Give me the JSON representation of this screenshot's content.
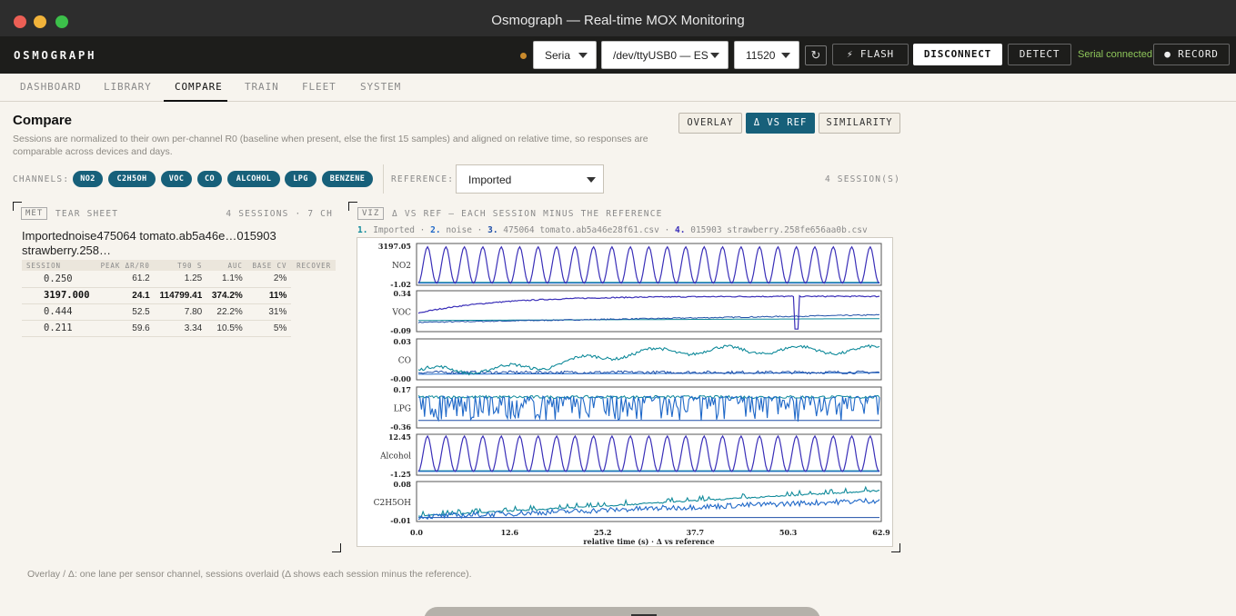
{
  "window": {
    "title": "Osmograph — Real-time MOX Monitoring"
  },
  "header": {
    "brand": "OSMOGRAPH",
    "protocol_value": "Seria",
    "port_value": "/dev/ttyUSB0 — ES",
    "baud_value": "11520",
    "refresh_glyph": "↻",
    "flash_label": "⚡ FLASH",
    "disconnect_label": "DISCONNECT",
    "detect_label": "DETECT",
    "connection_status": "Serial connected",
    "record_label": "● RECORD"
  },
  "nav": {
    "tabs": [
      {
        "label": "DASHBOARD"
      },
      {
        "label": "LIBRARY"
      },
      {
        "label": "COMPARE"
      },
      {
        "label": "TRAIN"
      },
      {
        "label": "FLEET"
      },
      {
        "label": "SYSTEM"
      }
    ],
    "active": "COMPARE"
  },
  "compare": {
    "title": "Compare",
    "description": "Sessions are normalized to their own per-channel R0 (baseline when present, else the first 15 samples) and aligned on relative time, so responses are comparable across devices and days.",
    "view_buttons": [
      {
        "label": "OVERLAY"
      },
      {
        "label": "Δ VS REF"
      },
      {
        "label": "SIMILARITY"
      }
    ],
    "channels_label": "CHANNELS:",
    "channels": [
      "NO2",
      "C2H5OH",
      "VOC",
      "CO",
      "ALCOHOL",
      "LPG",
      "BENZENE"
    ],
    "reference_label": "REFERENCE:",
    "reference_value": "Imported",
    "session_count": "4 SESSION(S)"
  },
  "tear_sheet": {
    "badge": "MET",
    "label": "TEAR SHEET",
    "meta": "4 SESSIONS · 7 CH",
    "title": "Importednoise475064 tomato.ab5a46e…015903 strawberry.258…",
    "columns": [
      "SESSION",
      "PEAK ΔR/R0",
      "T90 S",
      "AUC",
      "BASE CV",
      "RECOVER"
    ],
    "rows": [
      [
        "0.250",
        "61.2",
        "1.25",
        "1.1%",
        "2%",
        ""
      ],
      [
        "3197.000",
        "24.1",
        "114799.41",
        "374.2%",
        "11%",
        ""
      ],
      [
        "0.444",
        "52.5",
        "7.80",
        "22.2%",
        "31%",
        ""
      ],
      [
        "0.211",
        "59.6",
        "3.34",
        "10.5%",
        "5%",
        ""
      ]
    ]
  },
  "viz": {
    "badge": "VIZ",
    "label": "Δ VS REF — EACH SESSION MINUS THE REFERENCE",
    "legend": [
      {
        "num": "1.",
        "name": "Imported"
      },
      {
        "num": "2.",
        "name": "noise"
      },
      {
        "num": "3.",
        "name": "475064 tomato.ab5a46e28f61.csv"
      },
      {
        "num": "4.",
        "name": "015903 strawberry.258fe656aa0b.csv"
      }
    ]
  },
  "chart_data": {
    "type": "line",
    "xlabel": "relative time (s) · Δ vs reference",
    "x_ticks": [
      "0.0",
      "12.6",
      "25.2",
      "37.7",
      "50.3",
      "62.9"
    ],
    "xlim": [
      0,
      62.9
    ],
    "series_colors": [
      "#0f8a9a",
      "#1f68c8",
      "#1f4fa8",
      "#3a2fb8"
    ],
    "lanes": [
      {
        "channel": "NO2",
        "ymax": "3197.05",
        "ymin": "-1.02",
        "ylim": [
          -1.02,
          3197.05
        ]
      },
      {
        "channel": "VOC",
        "ymax": "0.34",
        "ymin": "-0.09",
        "ylim": [
          -0.09,
          0.34
        ]
      },
      {
        "channel": "CO",
        "ymax": "0.03",
        "ymin": "-0.00",
        "ylim": [
          -0.005,
          0.03
        ]
      },
      {
        "channel": "LPG",
        "ymax": "0.17",
        "ymin": "-0.36",
        "ylim": [
          -0.36,
          0.17
        ]
      },
      {
        "channel": "Alcohol",
        "ymax": "12.45",
        "ymin": "-1.25",
        "ylim": [
          -1.25,
          12.45
        ]
      },
      {
        "channel": "C2H5OH",
        "ymax": "0.08",
        "ymin": "-0.01",
        "ylim": [
          -0.01,
          0.08
        ]
      }
    ]
  },
  "footnote": "Overlay / Δ: one lane per sensor channel, sessions overlaid (Δ shows each session minus the reference)."
}
